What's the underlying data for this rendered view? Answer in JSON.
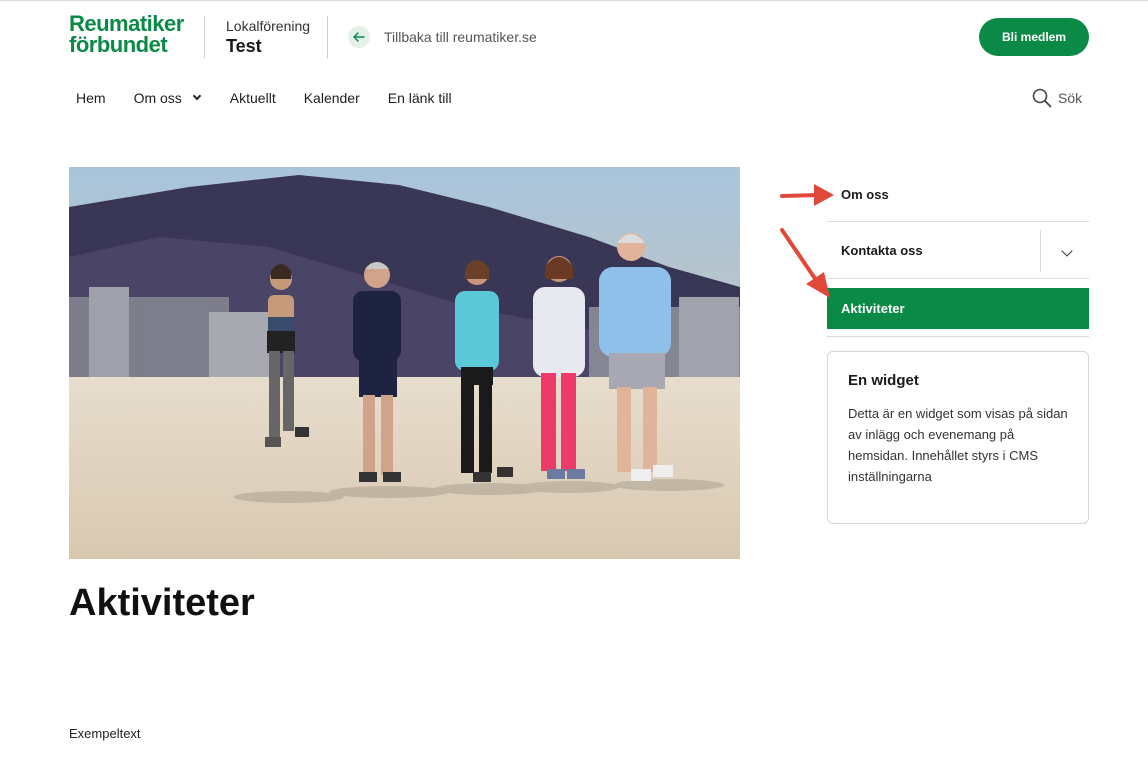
{
  "header": {
    "logo_line1": "Reumatiker",
    "logo_line2": "förbundet",
    "org_sub": "Lokalförening",
    "org_name": "Test",
    "back_label": "Tillbaka till reumatiker.se",
    "member_button": "Bli medlem"
  },
  "nav": {
    "items": [
      "Hem",
      "Om oss",
      "Aktuellt",
      "Kalender",
      "En länk till"
    ],
    "search_label": "Sök"
  },
  "main": {
    "title": "Aktiviteter",
    "body": "Exempeltext"
  },
  "sidebar": {
    "items": [
      "Om oss",
      "Kontakta oss",
      "Aktiviteter"
    ],
    "active_index": 2,
    "widget": {
      "title": "En widget",
      "body": "Detta är en widget som visas på sidan av inlägg och evenemang på hemsidan. Innehållet styrs i CMS inställningarna"
    }
  },
  "colors": {
    "brand_green": "#0b8a47",
    "annotation_red": "#e0483a"
  }
}
